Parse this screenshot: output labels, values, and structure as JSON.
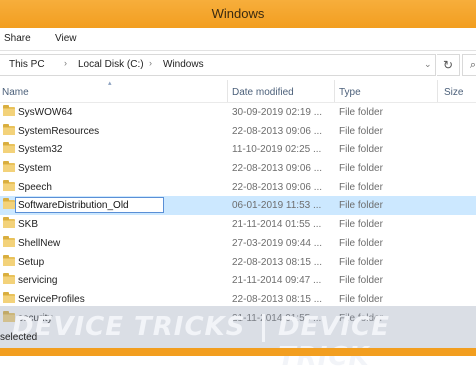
{
  "window": {
    "title": "Windows"
  },
  "ribbon": {
    "tabs": [
      "Share",
      "View"
    ]
  },
  "address": {
    "segments": [
      "This PC",
      "Local Disk (C:)",
      "Windows"
    ]
  },
  "columns": {
    "name": "Name",
    "date": "Date modified",
    "type": "Type",
    "size": "Size"
  },
  "files": [
    {
      "name": "SysWOW64",
      "date": "30-09-2019 02:19 ...",
      "type": "File folder"
    },
    {
      "name": "SystemResources",
      "date": "22-08-2013 09:06 ...",
      "type": "File folder"
    },
    {
      "name": "System32",
      "date": "11-10-2019 02:25 ...",
      "type": "File folder"
    },
    {
      "name": "System",
      "date": "22-08-2013 09:06 ...",
      "type": "File folder"
    },
    {
      "name": "Speech",
      "date": "22-08-2013 09:06 ...",
      "type": "File folder"
    },
    {
      "name": "SoftwareDistribution_Old",
      "date": "06-01-2019 11:53 ...",
      "type": "File folder"
    },
    {
      "name": "SKB",
      "date": "21-11-2014 01:55 ...",
      "type": "File folder"
    },
    {
      "name": "ShellNew",
      "date": "27-03-2019 09:44 ...",
      "type": "File folder"
    },
    {
      "name": "Setup",
      "date": "22-08-2013 08:15 ...",
      "type": "File folder"
    },
    {
      "name": "servicing",
      "date": "21-11-2014 09:47 ...",
      "type": "File folder"
    },
    {
      "name": "ServiceProfiles",
      "date": "22-08-2013 08:15 ...",
      "type": "File folder"
    },
    {
      "name": "security",
      "date": "21-11-2014 01:55 ...",
      "type": "File folder"
    }
  ],
  "status": {
    "text": "selected"
  },
  "watermark": {
    "left": "DEVICE TRICKS",
    "right": "DEVICE TRICK"
  }
}
